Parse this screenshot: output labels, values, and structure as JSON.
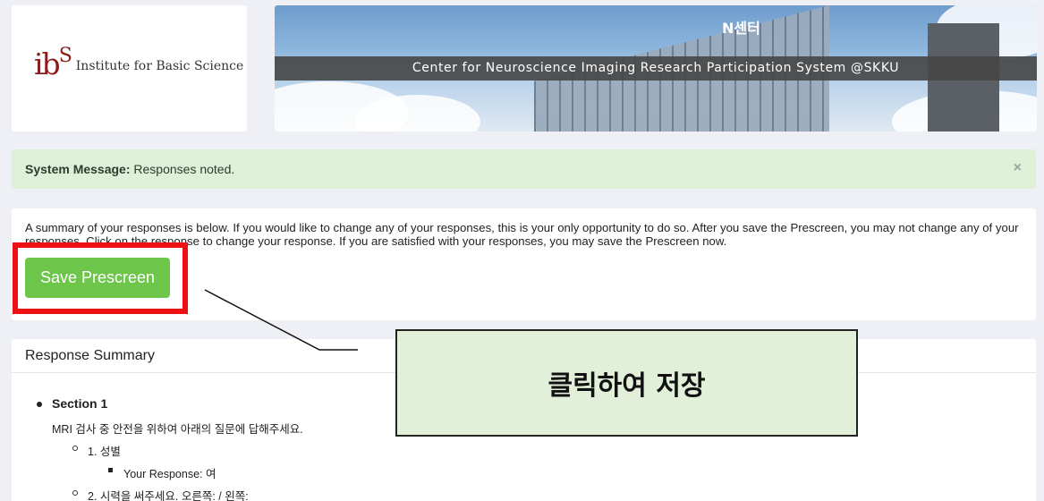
{
  "header": {
    "logo_mark": "ibS",
    "logo_text": "Institute for Basic Science",
    "banner_sign": "N센터",
    "banner_title": "Center for Neuroscience Imaging Research Participation System @SKKU"
  },
  "alert": {
    "label": "System Message:",
    "message": "Responses noted.",
    "close": "×"
  },
  "intro": {
    "text": "A summary of your responses is below. If you would like to change any of your responses, this is your only opportunity to do so. After you save the Prescreen, you may not change any of your responses. Click on the response to change your response. If you are satisfied with your responses, you may save the Prescreen now."
  },
  "actions": {
    "save_label": "Save Prescreen"
  },
  "summary": {
    "title": "Response Summary",
    "section_title": "Section 1",
    "section_desc": "MRI 검사 중 안전을 위하여 아래의 질문에 답해주세요.",
    "q1": "1. 성별",
    "r1": "Your Response: 여",
    "q2": "2. 시력을 써주세요. 오른쪽: / 왼쪽:"
  },
  "annotation": {
    "callout_text": "클릭하여 저장",
    "highlight_color": "#ee1111",
    "callout_bg": "#e2efd9"
  }
}
